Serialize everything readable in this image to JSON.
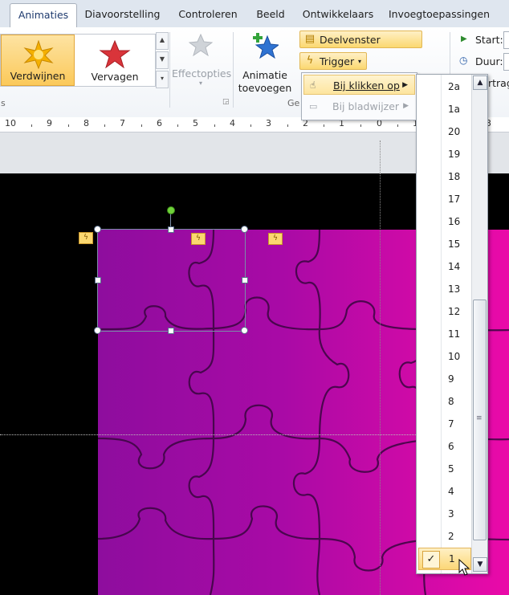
{
  "tabs": [
    {
      "label": "Animaties",
      "active": true
    },
    {
      "label": "Diavoorstelling"
    },
    {
      "label": "Controleren"
    },
    {
      "label": "Beeld"
    },
    {
      "label": "Ontwikkelaars"
    },
    {
      "label": "Invoegtoepassingen"
    }
  ],
  "gallery": {
    "items": [
      {
        "label": "Verdwijnen",
        "icon": "starburst-icon",
        "selected": true
      },
      {
        "label": "Vervagen",
        "icon": "red-star-icon"
      }
    ]
  },
  "effectopties": {
    "label": "Effectopties"
  },
  "animatie_toevoegen": {
    "line1": "Animatie",
    "line2": "toevoegen"
  },
  "group_label_partial": "Ge",
  "group_label_left_partial": "s",
  "deelvenster": {
    "label": "Deelvenster Animatie"
  },
  "trigger": {
    "label": "Trigger"
  },
  "timing": {
    "start_label": "Start:",
    "duration_label": "Duur:",
    "delay_partial": "rtrag"
  },
  "submenu": {
    "items": [
      {
        "label": "Bij klikken op",
        "hover": true
      },
      {
        "label": "Bij bladwijzer",
        "disabled": true
      }
    ]
  },
  "ruler": {
    "labels": [
      "10",
      "9",
      "8",
      "7",
      "6",
      "5",
      "4",
      "3",
      "2",
      "1",
      "0",
      "1",
      "2",
      "3"
    ]
  },
  "number_list": {
    "items": [
      "2a",
      "1a",
      "20",
      "19",
      "18",
      "17",
      "16",
      "15",
      "14",
      "13",
      "12",
      "11",
      "10",
      "9",
      "8",
      "7",
      "6",
      "5",
      "4",
      "3",
      "2",
      "1"
    ],
    "current": "1",
    "check_mark": "✓"
  },
  "colors": {
    "accent": "#fbd870",
    "ribbon_bg": "#f1f4f8",
    "slide_bg": "#000000",
    "puzzle_purple": "#8e0d9e",
    "puzzle_pink": "#e80aa6"
  }
}
